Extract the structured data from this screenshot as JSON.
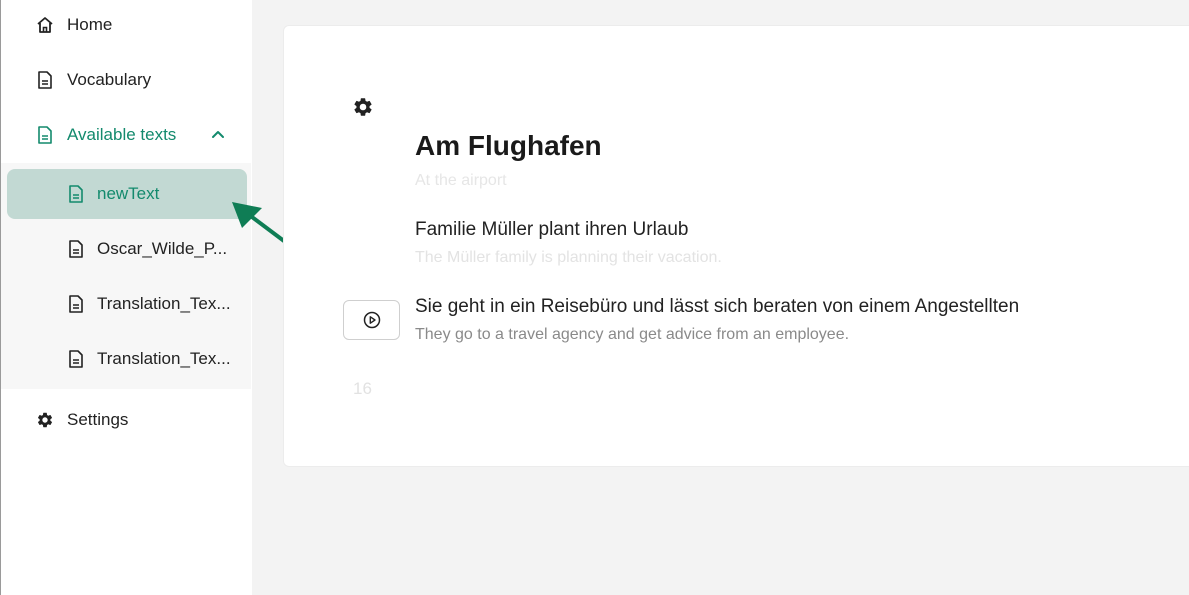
{
  "sidebar": {
    "home": {
      "label": "Home",
      "icon": "home-icon"
    },
    "vocabulary": {
      "label": "Vocabulary",
      "icon": "document-icon"
    },
    "available_texts": {
      "label": "Available texts",
      "icon": "document-text-icon",
      "expanded": true
    },
    "texts": [
      {
        "label": "newText",
        "active": true
      },
      {
        "label": "Oscar_Wilde_P...",
        "active": false
      },
      {
        "label": "Translation_Tex...",
        "active": false
      },
      {
        "label": "Translation_Tex...",
        "active": false
      }
    ],
    "settings": {
      "label": "Settings",
      "icon": "gear-icon"
    }
  },
  "content": {
    "title": "Am Flughafen",
    "title_translation": "At the airport",
    "sentences": [
      {
        "text": "Familie Müller plant ihren Urlaub",
        "translation": "The Müller family is planning their vacation."
      },
      {
        "text": "Sie geht in ein Reisebüro und lässt sich beraten von einem Angestellten",
        "translation": "They go to a travel agency and get advice from an employee."
      }
    ],
    "page_number": "16"
  },
  "colors": {
    "accent": "#138a6d",
    "active_bg": "#c2d9d3",
    "arrow": "#0f7d55"
  }
}
